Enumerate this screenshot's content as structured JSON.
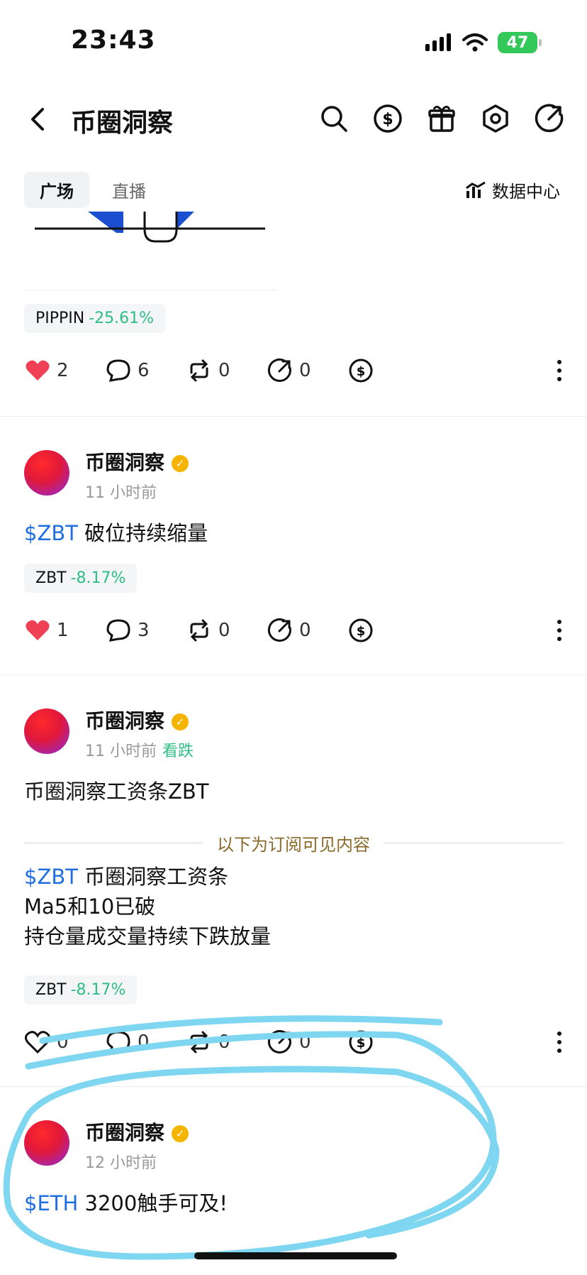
{
  "status_bar": {
    "time": "23:43",
    "battery": "47"
  },
  "header": {
    "title": "币圈洞察"
  },
  "tabs": [
    {
      "label": "广场",
      "active": true
    },
    {
      "label": "直播",
      "active": false
    }
  ],
  "data_center": "数据中心",
  "posts": [
    {
      "chip": {
        "symbol": "PIPPIN",
        "change": "-25.61%"
      },
      "actions": {
        "likes": "2",
        "comments": "6",
        "reposts": "0",
        "shares": "0",
        "liked": true
      }
    },
    {
      "author": "币圈洞察",
      "time": "11 小时前",
      "ticker": "$ZBT",
      "text": "破位持续缩量",
      "chip": {
        "symbol": "ZBT",
        "change": "-8.17%"
      },
      "actions": {
        "likes": "1",
        "comments": "3",
        "reposts": "0",
        "shares": "0",
        "liked": true
      }
    },
    {
      "author": "币圈洞察",
      "time": "11 小时前",
      "sentiment": "看跌",
      "text": "币圈洞察工资条ZBT",
      "subscribe_notice": "以下为订阅可见内容",
      "ticker": "$ZBT",
      "line1": "币圈洞察工资条",
      "line2": "Ma5和10已破",
      "line3": "持仓量成交量持续下跌放量",
      "chip": {
        "symbol": "ZBT",
        "change": "-8.17%"
      },
      "actions": {
        "likes": "0",
        "comments": "0",
        "reposts": "0",
        "shares": "0",
        "liked": false
      }
    },
    {
      "author": "币圈洞察",
      "time": "12 小时前",
      "ticker": "$ETH",
      "text": "3200触手可及!"
    }
  ],
  "colors": {
    "accent_blue": "#1f6fe0",
    "negative_green": "#2ebd85",
    "like_red": "#ef4056",
    "annotation_cyan": "#7fd6f0"
  }
}
